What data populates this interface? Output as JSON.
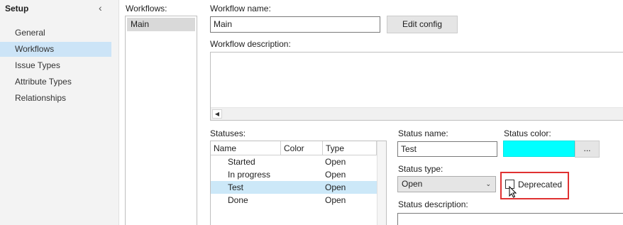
{
  "sidebar": {
    "title": "Setup",
    "collapse_icon": "chevron-left-icon",
    "items": [
      {
        "label": "General",
        "active": false
      },
      {
        "label": "Workflows",
        "active": true
      },
      {
        "label": "Issue Types",
        "active": false
      },
      {
        "label": "Attribute Types",
        "active": false
      },
      {
        "label": "Relationships",
        "active": false
      }
    ]
  },
  "workflows": {
    "label": "Workflows:",
    "items": [
      "Main"
    ],
    "selected": "Main"
  },
  "workflow_form": {
    "name_label": "Workflow name:",
    "name_value": "Main",
    "edit_config_label": "Edit config",
    "description_label": "Workflow description:",
    "description_value": ""
  },
  "statuses": {
    "label": "Statuses:",
    "columns": [
      "Name",
      "Color",
      "Type"
    ],
    "rows": [
      {
        "name": "Started",
        "color": "",
        "type": "Open",
        "selected": false
      },
      {
        "name": "In progress",
        "color": "",
        "type": "Open",
        "selected": false
      },
      {
        "name": "Test",
        "color": "",
        "type": "Open",
        "selected": true
      },
      {
        "name": "Done",
        "color": "",
        "type": "Open",
        "selected": false
      }
    ]
  },
  "status_form": {
    "name_label": "Status name:",
    "name_value": "Test",
    "color_label": "Status color:",
    "color_value": "#00FFFF",
    "color_picker_label": "...",
    "type_label": "Status type:",
    "type_value": "Open",
    "deprecated_label": "Deprecated",
    "deprecated_checked": false,
    "description_label": "Status description:",
    "description_value": ""
  },
  "colors": {
    "sidebar_selection": "#cce4f7",
    "list_selection": "#d9d9d9",
    "row_selection": "#cce8f8",
    "highlight_box": "#e03131"
  }
}
